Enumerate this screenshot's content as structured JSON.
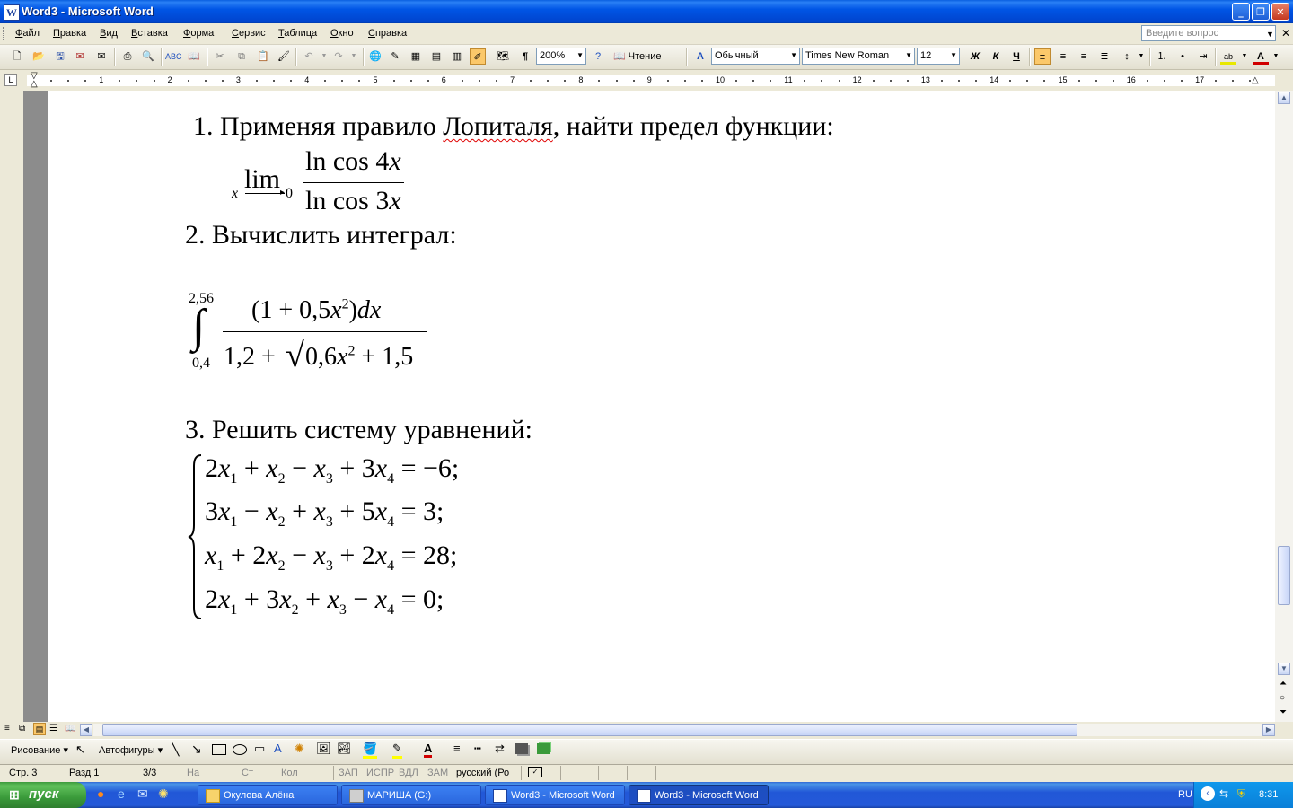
{
  "window": {
    "title": "Word3 - Microsoft Word",
    "min": "_",
    "max": "❐",
    "close": "✕"
  },
  "menu": {
    "items": [
      "Файл",
      "Правка",
      "Вид",
      "Вставка",
      "Формат",
      "Сервис",
      "Таблица",
      "Окно",
      "Справка"
    ],
    "help_placeholder": "Введите вопрос"
  },
  "toolbar": {
    "zoom": "200%",
    "read_label": "Чтение",
    "style": "Обычный",
    "font": "Times New Roman",
    "size": "12",
    "bold": "Ж",
    "italic": "К",
    "underline": "Ч",
    "pilcrow": "¶"
  },
  "ruler": {
    "numbers": [
      "1",
      "2",
      "3",
      "4",
      "5",
      "6",
      "7",
      "8",
      "9",
      "10",
      "11",
      "12",
      "13",
      "14",
      "15",
      "16",
      "17"
    ]
  },
  "document": {
    "task1": {
      "number": "1.",
      "text_before": "Применяя правило ",
      "misspelled": "Лопиталя",
      "text_after": ", найти предел функции:"
    },
    "task1_math": {
      "lim": "lim",
      "var": "x",
      "limit_to": "0",
      "num_ln": "ln cos 4",
      "den_ln": "ln cos 3"
    },
    "task2": {
      "text": "2. Вычислить интеграл:"
    },
    "task2_math": {
      "upper": "2,56",
      "lower": "0,4",
      "num": "(1 + 0,5",
      "num_pow": "2",
      "num_end": ")",
      "dx": "dx",
      "den_a": "1,2 +",
      "den_root": "0,6",
      "den_pow": "2",
      "den_end": "+ 1,5"
    },
    "task3": {
      "text": "3. Решить систему уравнений:"
    },
    "task3_math": {
      "eq1": {
        "a": "2",
        "t1": "+",
        "t2": "−",
        "c3": "+ 3",
        "rhs": "= −6;"
      },
      "eq2": {
        "a": "3",
        "t1": "−",
        "t2": "+",
        "c3": "+ 5",
        "rhs": "= 3;"
      },
      "eq3": {
        "a": "",
        "t1": "+ 2",
        "t2": "−",
        "c3": "+ 2",
        "rhs": "= 28;"
      },
      "eq4": {
        "a": "2",
        "t1": "+ 3",
        "t2": "+",
        "c3": "−",
        "rhs": "= 0;"
      }
    }
  },
  "drawbar": {
    "draw": "Рисование",
    "autoshapes": "Автофигуры"
  },
  "status": {
    "page": "Стр. 3",
    "section": "Разд 1",
    "pages": "3/3",
    "at": "На",
    "line": "Ст",
    "col": "Кол",
    "rec": "ЗАП",
    "trk": "ИСПР",
    "ext": "ВДЛ",
    "ovr": "ЗАМ",
    "lang": "русский (Ро"
  },
  "taskbar": {
    "start": "пуск",
    "tasks": [
      "Окулова Алёна",
      "МАРИША (G:)",
      "Word3 - Microsoft Word",
      "Word3 - Microsoft Word"
    ],
    "lang": "RU",
    "time": "8:31"
  }
}
